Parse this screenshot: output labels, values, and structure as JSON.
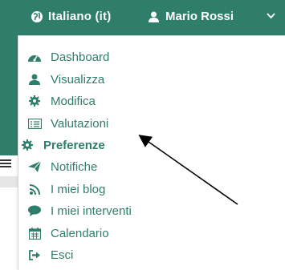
{
  "header": {
    "language_label": "Italiano (it)",
    "user_name": "Mario Rossi"
  },
  "menu": {
    "items": [
      {
        "label": "Dashboard",
        "icon": "dashboard-icon"
      },
      {
        "label": "Visualizza",
        "icon": "user-icon"
      },
      {
        "label": "Modifica",
        "icon": "gear-icon"
      },
      {
        "label": "Valutazioni",
        "icon": "list-icon"
      },
      {
        "label": "Preferenze",
        "icon": "gear-icon"
      },
      {
        "label": "Notifiche",
        "icon": "paper-plane-icon"
      },
      {
        "label": "I miei blog",
        "icon": "rss-icon"
      },
      {
        "label": "I miei interventi",
        "icon": "comment-icon"
      },
      {
        "label": "Calendario",
        "icon": "calendar-icon"
      },
      {
        "label": "Esci",
        "icon": "sign-out-icon"
      }
    ]
  },
  "colors": {
    "accent": "#2f7d6b",
    "menu_text": "#2f7d6b"
  }
}
